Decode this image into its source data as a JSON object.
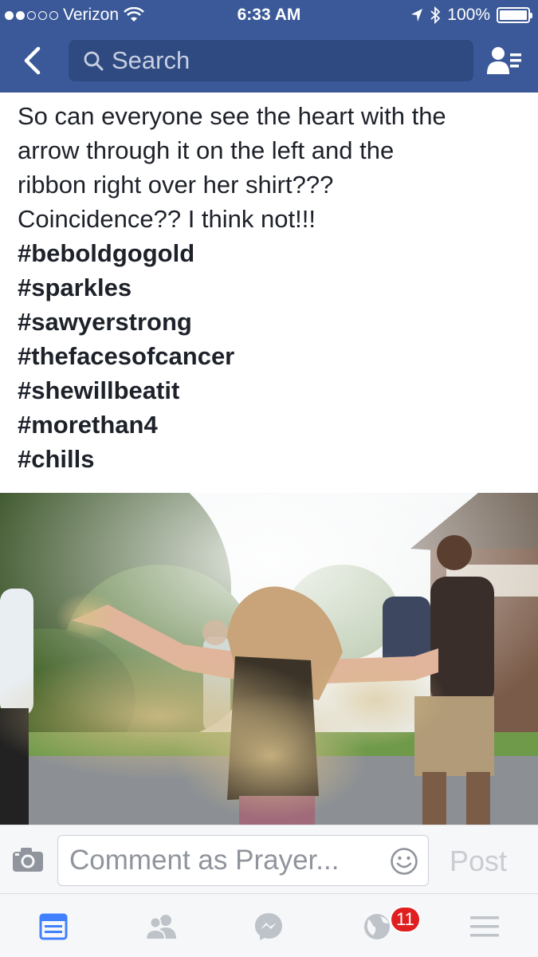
{
  "status_bar": {
    "carrier": "Verizon",
    "time": "6:33 AM",
    "battery": "100%",
    "battery_level": 1.0,
    "signal_bars_filled": 2,
    "signal_bars_total": 5
  },
  "nav": {
    "search_placeholder": "Search"
  },
  "post": {
    "text_lines": [
      "So can everyone see the heart with the",
      "arrow through it on the left and the",
      "ribbon right over her shirt???",
      "Coincidence?? I think not!!!"
    ],
    "hashtags": [
      "#beboldgogold",
      "#sparkles",
      "#sawyerstrong",
      "#thefacesofcancer",
      "#shewillbeatit",
      "#morethan4",
      "#chills"
    ]
  },
  "comment_bar": {
    "placeholder": "Comment as Prayer...",
    "post_label": "Post"
  },
  "tab_bar": {
    "notification_count": "11"
  },
  "colors": {
    "brand_blue": "#3b5998",
    "active_tab": "#4080ff",
    "inactive_tab": "#bec3c9",
    "badge_red": "#e02020"
  }
}
